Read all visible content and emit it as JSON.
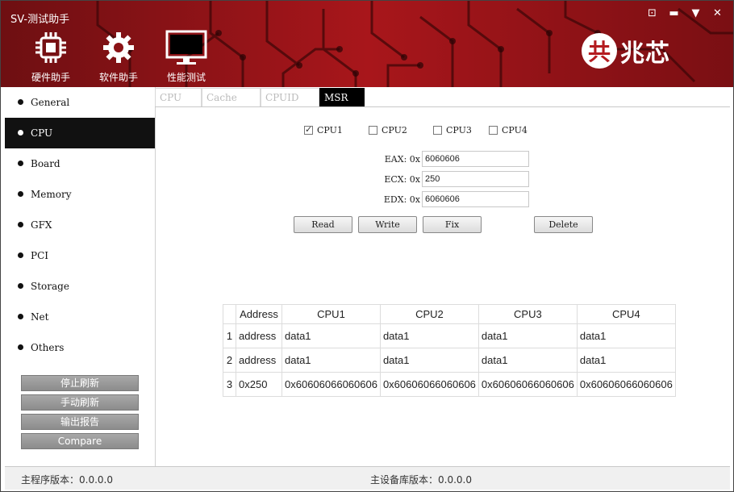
{
  "app": {
    "title": "SV-测试助手",
    "window_controls": [
      "⊡",
      "▬",
      "▼",
      "✕"
    ]
  },
  "topnav": [
    {
      "label": "硬件助手",
      "icon": "chip-icon"
    },
    {
      "label": "软件助手",
      "icon": "gear-icon"
    },
    {
      "label": "性能测试",
      "icon": "monitor-icon"
    }
  ],
  "brand": {
    "logo": "共",
    "name": "兆芯"
  },
  "sidebar": {
    "items": [
      {
        "label": "General"
      },
      {
        "label": "CPU"
      },
      {
        "label": "Board"
      },
      {
        "label": "Memory"
      },
      {
        "label": "GFX"
      },
      {
        "label": "PCI"
      },
      {
        "label": "Storage"
      },
      {
        "label": "Net"
      },
      {
        "label": "Others"
      }
    ],
    "active": "CPU",
    "buttons": [
      "停止刷新",
      "手动刷新",
      "输出报告",
      "Compare"
    ]
  },
  "tabs": [
    "CPU",
    "Cache",
    "CPUID",
    "MSR"
  ],
  "active_tab": "MSR",
  "checkboxes": [
    {
      "label": "CPU1",
      "checked": true
    },
    {
      "label": "CPU2",
      "checked": false
    },
    {
      "label": "CPU3",
      "checked": false
    },
    {
      "label": "CPU4",
      "checked": false
    }
  ],
  "registers": [
    {
      "label": "EAX: 0x",
      "value": "6060606"
    },
    {
      "label": "ECX: 0x",
      "value": "250"
    },
    {
      "label": "EDX: 0x",
      "value": "6060606"
    }
  ],
  "buttons": {
    "read": "Read",
    "write": "Write",
    "fix": "Fix",
    "delete": "Delete"
  },
  "table": {
    "headers": [
      "Address",
      "CPU1",
      "CPU2",
      "CPU3",
      "CPU4"
    ],
    "rows": [
      {
        "num": "1",
        "cells": [
          "address",
          "data1",
          "data1",
          "data1",
          "data1"
        ]
      },
      {
        "num": "2",
        "cells": [
          "address",
          "data1",
          "data1",
          "data1",
          "data1"
        ]
      },
      {
        "num": "3",
        "cells": [
          "0x250",
          "0x60606066060606",
          "0x60606066060606",
          "0x60606066060606",
          "0x60606066060606"
        ]
      }
    ]
  },
  "status": {
    "main_version": "主程序版本：0.0.0.0",
    "db_version": "主设备库版本：0.0.0.0"
  }
}
